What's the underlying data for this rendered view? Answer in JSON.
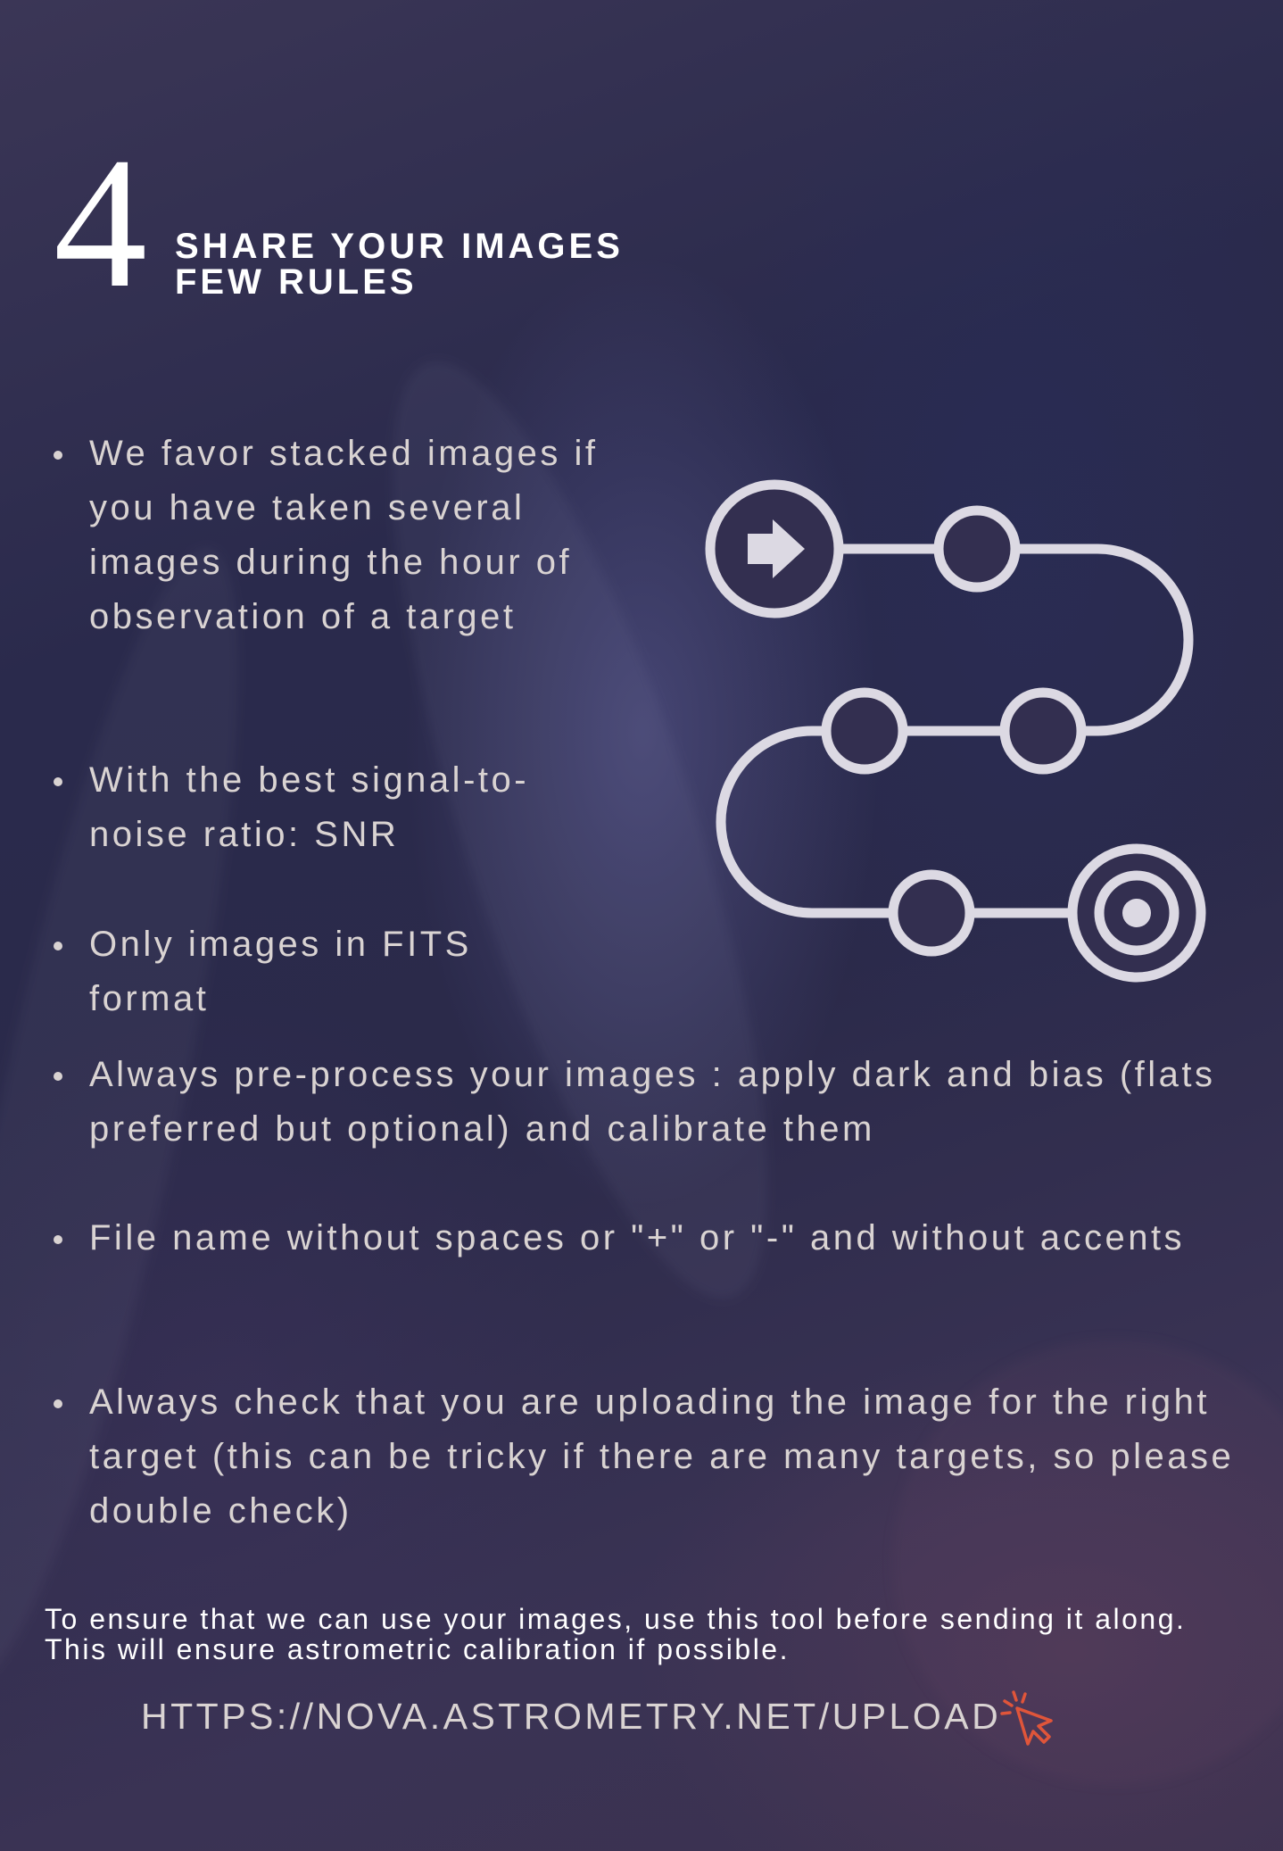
{
  "title": {
    "number": "4",
    "line1": "SHARE YOUR IMAGES",
    "line2": "FEW RULES"
  },
  "bullets": [
    "We favor stacked images if you have taken several images during the hour of observation of a target",
    "With the best signal-to-noise ratio: SNR",
    "Only images in FITS format",
    "Always pre-process your images : apply dark and bias (flats preferred but optional) and calibrate them",
    "File name without spaces or \"+\" or \"-\" and without accents",
    "Always check that you are uploading the image for the right target (this can be tricky if there are many targets, so please double check)"
  ],
  "footer": {
    "note": "To ensure that we can use your images, use this tool before sending it along. This will ensure astrometric calibration if possible.",
    "link": "HTTPS://NOVA.ASTROMETRY.NET/UPLOAD"
  },
  "colors": {
    "text": "#d9d3d2",
    "title": "#ffffff",
    "roadmap_stroke": "#dcd9e3",
    "cursor_accent": "#e0553a"
  },
  "icons": {
    "roadmap": "roadmap-path-icon",
    "start": "arrow-right-icon",
    "end": "target-icon",
    "cursor": "click-cursor-icon"
  }
}
